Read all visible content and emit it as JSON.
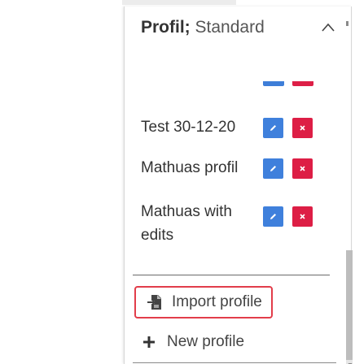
{
  "header": {
    "title_bold": "Profil;",
    "title_rest": "Standard"
  },
  "profiles": [
    {
      "name": "Test 30-12-20",
      "edit_icon": "pencil-icon",
      "delete_icon": "close-icon"
    },
    {
      "name": "Mathuas profil",
      "edit_icon": "pencil-icon",
      "delete_icon": "close-icon"
    },
    {
      "name": "Mathuas with edits",
      "edit_icon": "pencil-icon",
      "delete_icon": "close-icon"
    }
  ],
  "actions": {
    "import_label": "Import profile",
    "import_icon": "import-file-icon",
    "new_label": "New profile",
    "new_icon": "plus-icon"
  },
  "colors": {
    "edit": "#3f80dc",
    "delete": "#dd1e45",
    "highlight": "#e23d4a"
  }
}
